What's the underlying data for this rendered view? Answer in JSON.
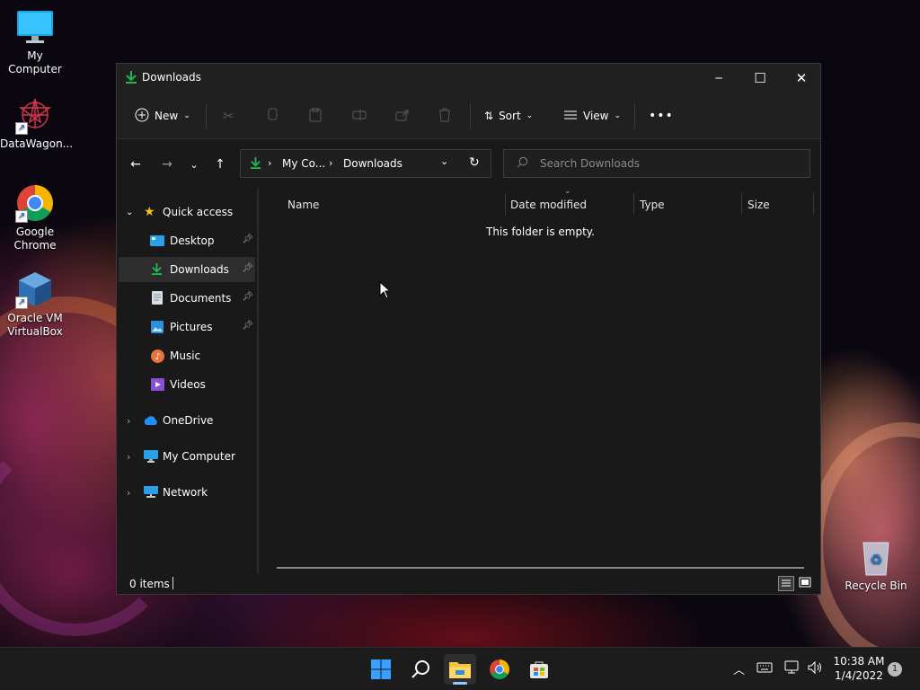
{
  "desktop": {
    "icons": [
      {
        "label": "My Computer"
      },
      {
        "label": "DataWagon..."
      },
      {
        "label": "Google Chrome"
      },
      {
        "label": "Oracle VM VirtualBox"
      },
      {
        "label": "Recycle Bin"
      }
    ]
  },
  "window": {
    "title": "Downloads",
    "controls": {
      "minimize": "─",
      "maximize": "☐",
      "close": "✕"
    }
  },
  "command_bar": {
    "new_label": "New",
    "sort_label": "Sort",
    "view_label": "View",
    "more_label": "•••"
  },
  "nav": {
    "breadcrumb": [
      "My Co...",
      "Downloads"
    ],
    "search_placeholder": "Search Downloads"
  },
  "sidebar": {
    "quick_access": "Quick access",
    "items": [
      {
        "label": "Desktop",
        "pinned": true
      },
      {
        "label": "Downloads",
        "pinned": true,
        "selected": true
      },
      {
        "label": "Documents",
        "pinned": true
      },
      {
        "label": "Pictures",
        "pinned": true
      },
      {
        "label": "Music",
        "pinned": false
      },
      {
        "label": "Videos",
        "pinned": false
      }
    ],
    "sections": [
      {
        "label": "OneDrive"
      },
      {
        "label": "My Computer"
      },
      {
        "label": "Network"
      }
    ]
  },
  "content": {
    "columns": [
      "Name",
      "Date modified",
      "Type",
      "Size"
    ],
    "empty_message": "This folder is empty."
  },
  "status": {
    "items_count": "0 items"
  },
  "taskbar": {
    "clock_time": "10:38 AM",
    "clock_date": "1/4/2022",
    "notification_count": "1"
  },
  "colors": {
    "accent": "#0a84ff",
    "download_green": "#1db954"
  }
}
